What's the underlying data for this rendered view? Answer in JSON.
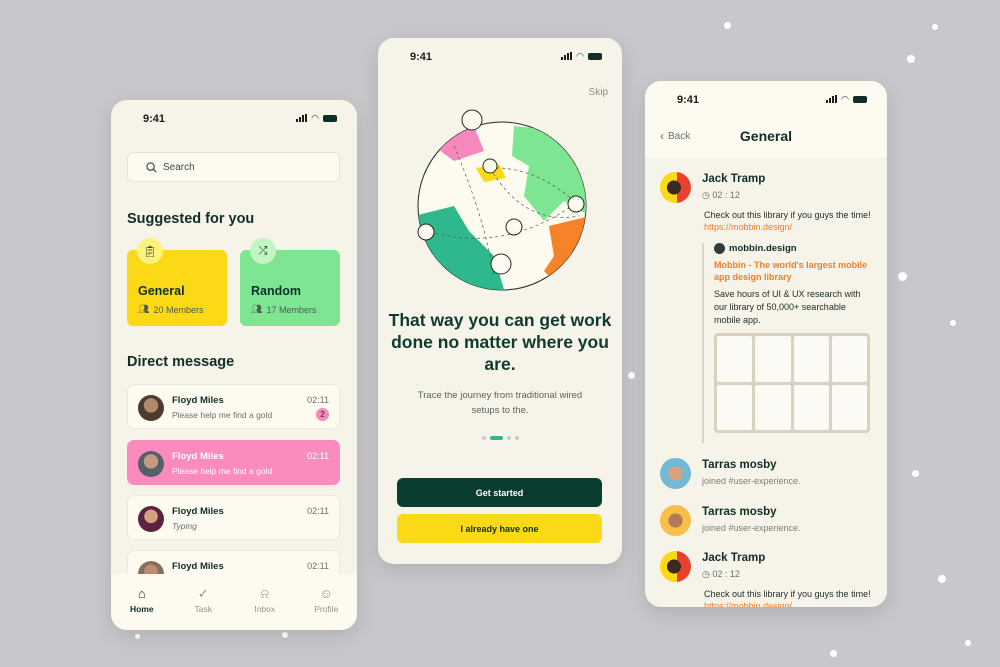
{
  "status_bar": {
    "time": "9:41"
  },
  "home_screen": {
    "search": {
      "placeholder": "Search",
      "icon": "search-icon"
    },
    "suggested_title": "Suggested for you",
    "channels": [
      {
        "name": "General",
        "members": "20 Members",
        "icon": "clipboard-icon",
        "color": "#fbd916"
      },
      {
        "name": "Random",
        "members": "17 Members",
        "icon": "shuffle-icon",
        "color": "#7ee592"
      }
    ],
    "dm_title": "Direct message",
    "direct_messages": [
      {
        "name": "Floyd Miles",
        "time": "02:11",
        "message": "Please help me find a gold",
        "unread": "2",
        "active": false
      },
      {
        "name": "Floyd Miles",
        "time": "02:11",
        "message": "Please help me find a gold",
        "unread": null,
        "active": true
      },
      {
        "name": "Floyd Miles",
        "time": "02:11",
        "message": "Typing",
        "unread": null,
        "active": false
      },
      {
        "name": "Floyd Miles",
        "time": "02:11",
        "message": "",
        "unread": null,
        "active": false
      }
    ],
    "tabs": [
      {
        "label": "Home",
        "icon": "home-icon",
        "active": true
      },
      {
        "label": "Task",
        "icon": "check-circle-icon",
        "active": false
      },
      {
        "label": "Inbox",
        "icon": "bell-icon",
        "active": false
      },
      {
        "label": "Profile",
        "icon": "user-icon",
        "active": false
      }
    ]
  },
  "onboarding_screen": {
    "skip_label": "Skip",
    "headline": "That way you can get work done no matter where you are.",
    "subtitle": "Trace the journey from traditional wired setups to the.",
    "page_indicator": {
      "total": 4,
      "current": 2
    },
    "primary_button": "Get started",
    "secondary_button": "I already have one"
  },
  "channel_screen": {
    "back_label": "Back",
    "title": "General",
    "posts": [
      {
        "name": "Jack Tramp",
        "time": "02 : 12",
        "text": "Check out this library if you guys the time! ",
        "link": "https://mobbin.design/",
        "preview": {
          "site": "mobbin.design",
          "title": "Mobbin - The world's largest mobile app design library",
          "description": "Save hours of UI & UX research with our library of 50,000+ searchable mobile app."
        }
      },
      {
        "name": "Tarras mosby",
        "activity": "joined #user-experience."
      },
      {
        "name": "Tarras mosby",
        "activity": "joined #user-experience."
      },
      {
        "name": "Jack Tramp",
        "time": "02 : 12",
        "text": "Check out this library if you guys the time! ",
        "link": "https://mobbin.design/"
      }
    ]
  }
}
